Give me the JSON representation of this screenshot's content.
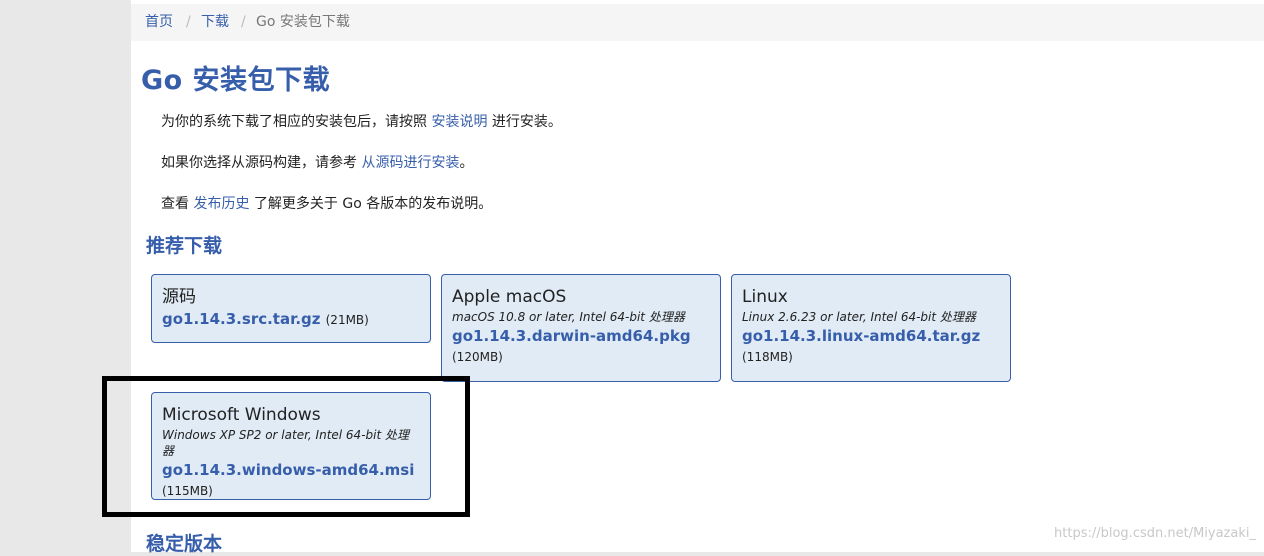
{
  "breadcrumb": {
    "home": "首页",
    "downloads": "下载",
    "current": "Go 安装包下载",
    "separator": "/"
  },
  "title": "Go 安装包下载",
  "intro": {
    "p1_before": "为你的系统下载了相应的安装包后，请按照",
    "p1_link": "安装说明",
    "p1_after": "进行安装。",
    "p2_before": "如果你选择从源码构建，请参考",
    "p2_link": "从源码进行安装",
    "p2_after": "。",
    "p3_before": "查看",
    "p3_link": "发布历史",
    "p3_after": "了解更多关于 Go 各版本的发布说明。"
  },
  "featured": {
    "heading": "推荐下载",
    "cards": [
      {
        "os": "源码",
        "requirement": "",
        "file": "go1.14.3.src.tar.gz",
        "size": "(21MB)"
      },
      {
        "os": "Apple macOS",
        "requirement": "macOS 10.8 or later, Intel 64-bit 处理器",
        "file": "go1.14.3.darwin-amd64.pkg",
        "size": "(120MB)"
      },
      {
        "os": "Linux",
        "requirement": "Linux 2.6.23 or later, Intel 64-bit 处理器",
        "file": "go1.14.3.linux-amd64.tar.gz",
        "size": "(118MB)"
      },
      {
        "os": "Microsoft Windows",
        "requirement": "Windows XP SP2 or later, Intel 64-bit 处理器",
        "file": "go1.14.3.windows-amd64.msi",
        "size": "(115MB)"
      }
    ]
  },
  "stable_heading": "稳定版本",
  "watermark": "https://blog.csdn.net/Miyazaki_",
  "colors": {
    "link": "#375eab",
    "card_bg": "#e0ebf5",
    "breadcrumb_bg": "#f5f5f5",
    "highlight": "#000000"
  }
}
